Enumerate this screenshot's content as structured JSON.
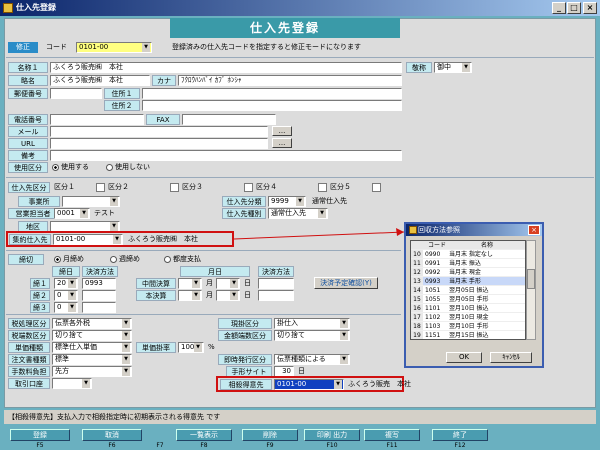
{
  "window": {
    "title": "仕入先登録"
  },
  "header": {
    "page_title": "仕入先登録",
    "mode_badge": "修正",
    "code_label": "コード",
    "code_value": "0101-00",
    "hint": "登録済みの仕入先コードを指定すると修正モードになります"
  },
  "basic": {
    "name1_label": "名称１",
    "name1_value": "ふくろう販売㈱　本社",
    "honorific_label": "敬称",
    "honorific_value": "御中",
    "short_label": "略名",
    "short_value": "ふくろう販売㈱　本社",
    "kana_label": "カナ",
    "kana_value": "ﾌｸﾛｳﾊﾝﾊﾞｲ ｶﾌﾞ ﾎﾝｼｬ",
    "zip_label": "郵便番号",
    "addr1_label": "住所１",
    "addr2_label": "住所２",
    "tel_label": "電話番号",
    "fax_label": "FAX",
    "mail_label": "メール",
    "url_label": "URL",
    "memo_label": "備考",
    "use_label": "使用区分",
    "use_opt1": "使用する",
    "use_opt2": "使用しない",
    "ellipsis": "..."
  },
  "supplier": {
    "kbn_label": "仕入先区分",
    "kbn1": "区分１",
    "kbn2": "区分２",
    "kbn3": "区分３",
    "kbn4": "区分４",
    "kbn5": "区分５",
    "office_label": "事業所",
    "staff_label": "営業担当者",
    "staff_code": "0001",
    "staff_name": "テスト",
    "area_label": "地区",
    "cat_label": "仕入先分類",
    "cat_code": "9999",
    "cat_name": "通常仕入先",
    "type_label": "仕入先種別",
    "type_value": "通常仕入先",
    "consol_label": "集約仕入先",
    "consol_code": "0101-00",
    "consol_name": "ふくろう販売㈱　本社"
  },
  "closing": {
    "label": "締切",
    "opt1": "月締め",
    "opt2": "週締め",
    "opt3": "都度支払",
    "col_day": "締日",
    "col_method": "決済方法",
    "col_month": "月日",
    "col_method2": "決済方法",
    "row1": "締１",
    "row2": "締２",
    "row3": "締３",
    "row1_day": "20",
    "row1_method": "0993",
    "row2_day": "0",
    "row3_day": "0",
    "mid_label": "中間決算",
    "main_label": "本決算",
    "month_unit": "月",
    "day_unit": "日",
    "plan_button": "決済予定確認(Y)"
  },
  "tax": {
    "calc_label": "税処理区分",
    "calc_value": "伝票各外税",
    "round_label": "税端数区分",
    "round_value": "切り捨て",
    "price_label": "単価種類",
    "price_value": "標準仕入単価",
    "rate_label": "単価掛率",
    "rate_value": "100",
    "rate_unit": "%",
    "order_label": "注文書種類",
    "order_value": "標準",
    "fee_label": "手数料負担",
    "fee_value": "先方",
    "bank_label": "取引口座"
  },
  "payment": {
    "cur_label": "現掛区分",
    "cur_value": "掛仕入",
    "amount_label": "金額端数区分",
    "amount_value": "切り捨て",
    "issue_label": "即時発行区分",
    "issue_value": "伝票種類による",
    "site_label": "手形サイト",
    "site_value": "30",
    "site_unit": "日",
    "offset_label": "相殺得意先",
    "offset_code": "0101-00",
    "offset_name": "ふくろう販売　本社"
  },
  "popup": {
    "title": "回収方法参照",
    "col_code": "コード",
    "col_name": "名称",
    "rows": [
      {
        "no": "10",
        "code": "0990",
        "name": "当月末 指定なし"
      },
      {
        "no": "11",
        "code": "0991",
        "name": "当月末 振込"
      },
      {
        "no": "12",
        "code": "0992",
        "name": "当月末 現金"
      },
      {
        "no": "13",
        "code": "0993",
        "name": "当月末 手形"
      },
      {
        "no": "14",
        "code": "1051",
        "name": "翌月05日 振込"
      },
      {
        "no": "15",
        "code": "1055",
        "name": "翌月05日 手形"
      },
      {
        "no": "16",
        "code": "1101",
        "name": "翌月10日 振込"
      },
      {
        "no": "17",
        "code": "1102",
        "name": "翌月10日 現金"
      },
      {
        "no": "18",
        "code": "1103",
        "name": "翌月10日 手形"
      },
      {
        "no": "19",
        "code": "1151",
        "name": "翌月15日 振込"
      }
    ],
    "ok": "OK",
    "cancel": "ｷｬﾝｾﾙ"
  },
  "status": {
    "text": "【相殺得意先】支払入力で相殺指定時に初期表示される得意先 です"
  },
  "fkeys": [
    {
      "label": "登録",
      "key": "F5"
    },
    {
      "label": "取消",
      "key": "F6"
    },
    {
      "label": "",
      "key": "F7"
    },
    {
      "label": "一覧表示",
      "key": "F8"
    },
    {
      "label": "削除",
      "key": "F9"
    },
    {
      "label": "印刷 出力",
      "key": "F10"
    },
    {
      "label": "複写",
      "key": "F11"
    },
    {
      "label": "終了",
      "key": "F12"
    }
  ],
  "colors": {
    "title_bar": "#0a246a",
    "panel_header": "#3a9aa8",
    "highlight": "#d01010",
    "label_bg": "#c4eaf0"
  }
}
